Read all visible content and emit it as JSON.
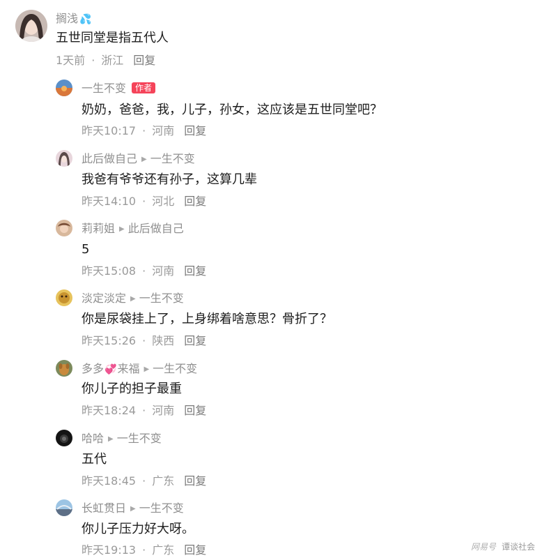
{
  "comments": [
    {
      "user": "搁浅",
      "content": "五世同堂是指五代人",
      "time": "1天前",
      "location": "浙江",
      "reply": "回复"
    },
    {
      "user": "一生不变",
      "badge": "作者",
      "content": "奶奶，爸爸，我，儿子，孙女，这应该是五世同堂吧？",
      "time": "昨天10:17",
      "location": "河南",
      "reply": "回复"
    },
    {
      "user": "此后做自己",
      "reply_to": "一生不变",
      "content": "我爸有爷爷还有孙子，这算几辈",
      "time": "昨天14:10",
      "location": "河北",
      "reply": "回复"
    },
    {
      "user": "莉莉姐",
      "reply_to": "此后做自己",
      "content": "5",
      "time": "昨天15:08",
      "location": "河南",
      "reply": "回复"
    },
    {
      "user": "淡定淡定",
      "reply_to": "一生不变",
      "content": "你是尿袋挂上了，上身绑着啥意思？骨折了？",
      "time": "昨天15:26",
      "location": "陕西",
      "reply": "回复"
    },
    {
      "user_a": "多多",
      "user_b": "来福",
      "reply_to": "一生不变",
      "content": "你儿子的担子最重",
      "time": "昨天18:24",
      "location": "河南",
      "reply": "回复"
    },
    {
      "user": "哈哈",
      "reply_to": "一生不变",
      "content": "五代",
      "time": "昨天18:45",
      "location": "广东",
      "reply": "回复"
    },
    {
      "user": "长虹贯日",
      "reply_to": "一生不变",
      "content": "你儿子压力好大呀。",
      "time": "昨天19:13",
      "location": "广东",
      "reply": "回复"
    }
  ],
  "watermark": {
    "logo": "网易号",
    "text": "谭谈社会"
  },
  "colors": {
    "author_badge": "#f5445a",
    "meta_text": "#9a9a9a",
    "username": "#8f8f8f"
  }
}
